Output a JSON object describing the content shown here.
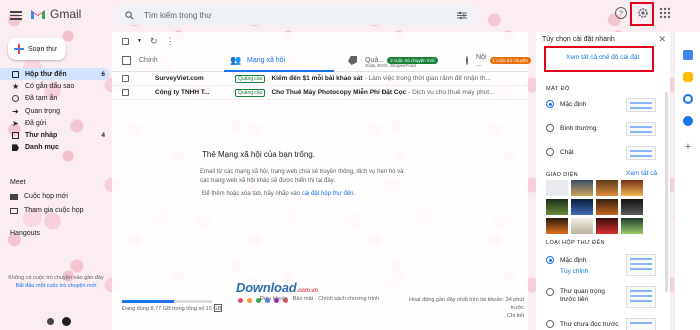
{
  "app": {
    "name": "Gmail"
  },
  "search": {
    "placeholder": "Tìm kiếm trong thư"
  },
  "compose_label": "Soạn thư",
  "nav": [
    {
      "label": "Hộp thư đến",
      "count": "6",
      "active": true
    },
    {
      "label": "Có gắn dấu sao",
      "count": ""
    },
    {
      "label": "Đã tạm ẩn",
      "count": ""
    },
    {
      "label": "Quan trọng",
      "count": ""
    },
    {
      "label": "Đã gửi",
      "count": ""
    },
    {
      "label": "Thư nháp",
      "count": "4"
    },
    {
      "label": "Danh mục",
      "count": ""
    }
  ],
  "meet": {
    "title": "Meet",
    "items": [
      "Cuộc họp mới",
      "Tham gia cuộc họp"
    ]
  },
  "hangouts": {
    "title": "Hangouts",
    "no_chats": "Không có cuộc trò chuyện nào gần đây",
    "start_link": "Bắt đầu một cuộc trò chuyện mới"
  },
  "tabs": [
    {
      "label": "Chính"
    },
    {
      "label": "Mạng xã hội",
      "active": true
    },
    {
      "label": "Quả...",
      "badge": "3 cuộc trò chuyện mới",
      "sub": "Grab, BOO, ShopeeFood",
      "badge_color": "#188038"
    },
    {
      "label": "Nội ...",
      "badge": "1 cuộc trò chuyện",
      "badge_color": "#e8710a"
    }
  ],
  "emails": [
    {
      "sender": "SurveyViet.com",
      "ad": "Quảng cáo",
      "subject": "Kiếm đến $1 mỗi bài khảo sát",
      "snippet": " - Làm việc trong thời gian rảnh để nhận th..."
    },
    {
      "sender": "Công ty TNHH T...",
      "ad": "Quảng cáo",
      "subject": "Cho Thuê Máy Photocopy Miễn Phí Đặt Cọc",
      "snippet": " - Dịch vụ cho thuê máy phot..."
    }
  ],
  "empty_state": {
    "title": "Thẻ Mạng xã hội của bạn trống.",
    "description": "Email từ các mạng xã hội, trang web chia sẻ truyền thông, dịch vụ hẹn hò và các trang web xã hội khác sẽ được hiển thị tại đây.",
    "link_prefix": "Để thêm hoặc xóa tab, hãy nhấp vào ",
    "link_text": "cài đặt hộp thư đến",
    "link_suffix": "."
  },
  "footer": {
    "storage": "Đang dùng 8,77 GB trong tổng số 15 GB",
    "storage_fraction": 0.58,
    "links": "Điều khoản · Bảo mật · Chính sách chương trình",
    "activity": "Hoạt động gần đây nhất trên tài khoản: 34 phút trước",
    "details": "Chi tiết"
  },
  "watermark": {
    "text": "Download",
    "suffix": ".com.vn"
  },
  "quick_settings": {
    "title": "Tùy chọn cài đặt nhanh",
    "see_all": "Xem tất cả chế độ cài đặt",
    "density": {
      "title": "MẬT ĐỘ",
      "options": [
        "Mặc định",
        "Bình thường",
        "Chật"
      ]
    },
    "theme": {
      "title": "GIAO DIỆN",
      "see_all": "Xem tất cả"
    },
    "inbox_type": {
      "title": "LOẠI HỘP THƯ ĐẾN",
      "options": [
        "Mặc định",
        "Thư quan trọng trước tiên",
        "Thư chưa đọc trước"
      ],
      "customize": "Tùy chỉnh"
    }
  },
  "colors": {
    "accent": "#1a73e8",
    "highlight": "#e3001b",
    "active_nav": "#d3e3fd"
  }
}
